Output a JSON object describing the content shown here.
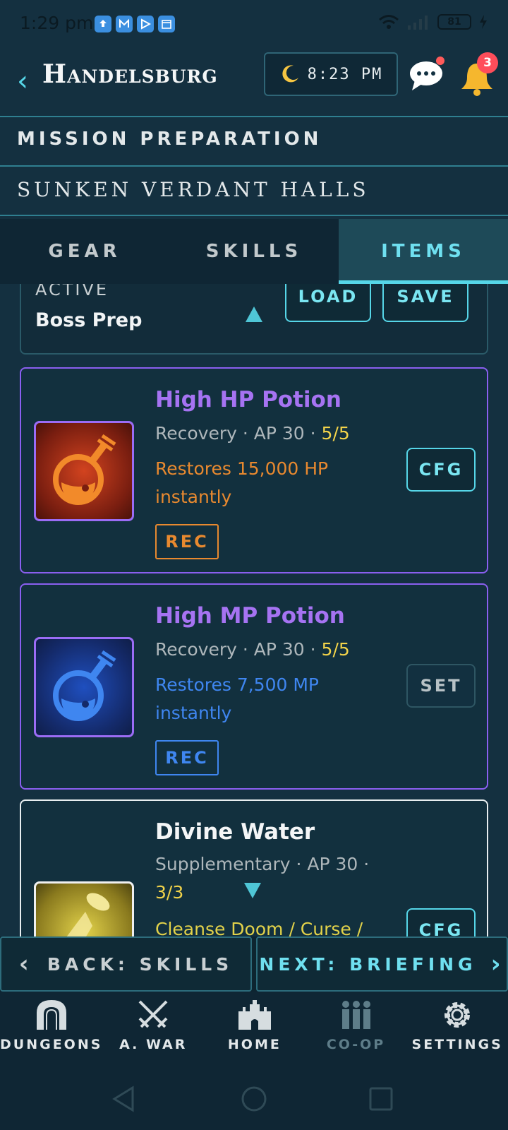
{
  "status_bar": {
    "time": "1:29 pm",
    "battery": "81"
  },
  "header": {
    "title": "Handelsburg",
    "clock": "8:23 PM",
    "notifications_count": "3"
  },
  "mission": {
    "label": "MISSION PREPARATION",
    "dungeon": "SUNKEN VERDANT HALLS"
  },
  "tabs": [
    {
      "label": "GEAR",
      "active": false
    },
    {
      "label": "SKILLS",
      "active": false
    },
    {
      "label": "ITEMS",
      "active": true
    }
  ],
  "loadout": {
    "label": "ACTIVE",
    "name": "Boss Prep",
    "load_label": "LOAD",
    "save_label": "SAVE"
  },
  "items": [
    {
      "name": "High HP Potion",
      "category": "Recovery · AP 30 · ",
      "qty": "5/5",
      "desc": "Restores 15,000 HP instantly",
      "tag": "REC",
      "action": "CFG",
      "accent": "#e8892f"
    },
    {
      "name": "High MP Potion",
      "category": "Recovery · AP 30 · ",
      "qty": "5/5",
      "desc": "Restores 7,500 MP instantly",
      "tag": "REC",
      "action": "SET",
      "accent": "#3f86f0"
    },
    {
      "name": "Divine Water",
      "category": "Supplementary · AP 30 · ",
      "qty": "3/3",
      "desc": "Cleanse Doom / Curse /",
      "action": "CFG",
      "accent": "#e2d24a"
    }
  ],
  "nav": {
    "back_label": "BACK: SKILLS",
    "next_label": "NEXT: BRIEFING"
  },
  "bottom_nav": [
    {
      "label": "DUNGEONS",
      "icon": "archway-icon"
    },
    {
      "label": "A. WAR",
      "icon": "crossed-swords-icon"
    },
    {
      "label": "HOME",
      "icon": "castle-icon"
    },
    {
      "label": "CO-OP",
      "icon": "group-icon"
    },
    {
      "label": "SETTINGS",
      "icon": "gear-icon"
    }
  ]
}
